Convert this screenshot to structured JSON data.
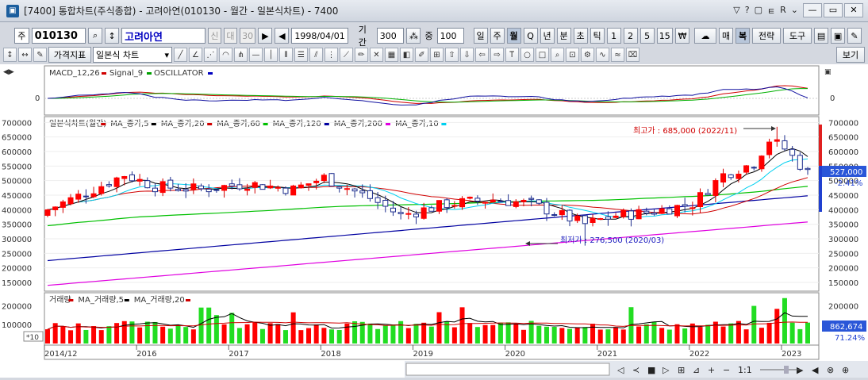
{
  "title": "[7400] 통합차트(주식종합) - 고려아연(010130 - 월간 - 일본식차트) - 7400",
  "title_tools": [
    "▽",
    "?",
    "▢",
    "ㅌ",
    "R",
    "⌄"
  ],
  "win_buttons": [
    "—",
    "▭",
    "✕"
  ],
  "toolbar1": {
    "market": "주",
    "code": "010130",
    "stock_name": "고려아연",
    "credit1": "신",
    "credit2": "대",
    "credit3": "30",
    "date": "1998/04/01",
    "period_label": "기간",
    "period_value": "300",
    "count_label": "중",
    "count_value": "100",
    "intervals": [
      "일",
      "주",
      "월",
      "Q",
      "년",
      "분",
      "초",
      "틱",
      "1",
      "2",
      "5",
      "15",
      "₩"
    ],
    "active_interval": "월",
    "right_btns": [
      "매",
      "복",
      "전략",
      "도구"
    ]
  },
  "toolbar2": {
    "indicator_btn": "가격지표",
    "chart_type": "일본식 차트",
    "view_btn": "보기"
  },
  "macd_legend": [
    {
      "text": "MACD_12,26",
      "color": "#d00000"
    },
    {
      "text": "Signal_9",
      "color": "#00a000"
    },
    {
      "text": "OSCILLATOR",
      "color": "#0000c0"
    }
  ],
  "macd_zero_label": "0",
  "price_legend": [
    {
      "text": "일본식차트(월간)",
      "color": "#d00000"
    },
    {
      "text": "MA_종가,5",
      "color": "#000000"
    },
    {
      "text": "MA_종가,20",
      "color": "#d00000"
    },
    {
      "text": "MA_종가,60",
      "color": "#00c000"
    },
    {
      "text": "MA_종가,120",
      "color": "#0000a0"
    },
    {
      "text": "MA_종가,200",
      "color": "#e000e0"
    },
    {
      "text": "MA_종가,10",
      "color": "#00d0f0"
    }
  ],
  "high_annotation": "최고가 : 685,000 (2022/11)",
  "low_annotation": "최저가 : 276,500 (2020/03)",
  "price_badge": {
    "price": "527,000",
    "change": "-2.41%"
  },
  "volume_legend": [
    {
      "text": "거래량",
      "color": "#d00000"
    },
    {
      "text": "MA_거래량,5",
      "color": "#000000"
    },
    {
      "text": "MA_거래량,20",
      "color": "#d00000"
    }
  ],
  "volume_badge": {
    "value": "862,674",
    "pct": "71.24%"
  },
  "volume_multiplier": "*10",
  "bottom_controls": [
    "◁",
    "≺",
    "■",
    "▷",
    "⊞",
    "⊿",
    "+",
    "−",
    "1:1",
    "▶",
    "◀",
    "⊗",
    "⊕"
  ],
  "chart_data": [
    {
      "type": "line",
      "title": "MACD_12,26 Signal_9 OSCILLATOR",
      "yticks": [
        "0"
      ]
    },
    {
      "type": "candlestick",
      "title": "일본식차트(월간)",
      "x_ticks": [
        "2014/12",
        "2016",
        "2017",
        "2018",
        "2019",
        "2020",
        "2021",
        "2022",
        "2023"
      ],
      "y_ticks": [
        150000,
        200000,
        250000,
        300000,
        350000,
        400000,
        450000,
        500000,
        550000,
        600000,
        650000,
        700000
      ],
      "ylim": [
        120000,
        720000
      ],
      "annotations": {
        "high": 685000,
        "low": 276500
      }
    },
    {
      "type": "bar",
      "title": "거래량",
      "y_ticks": [
        100000,
        200000
      ]
    }
  ]
}
